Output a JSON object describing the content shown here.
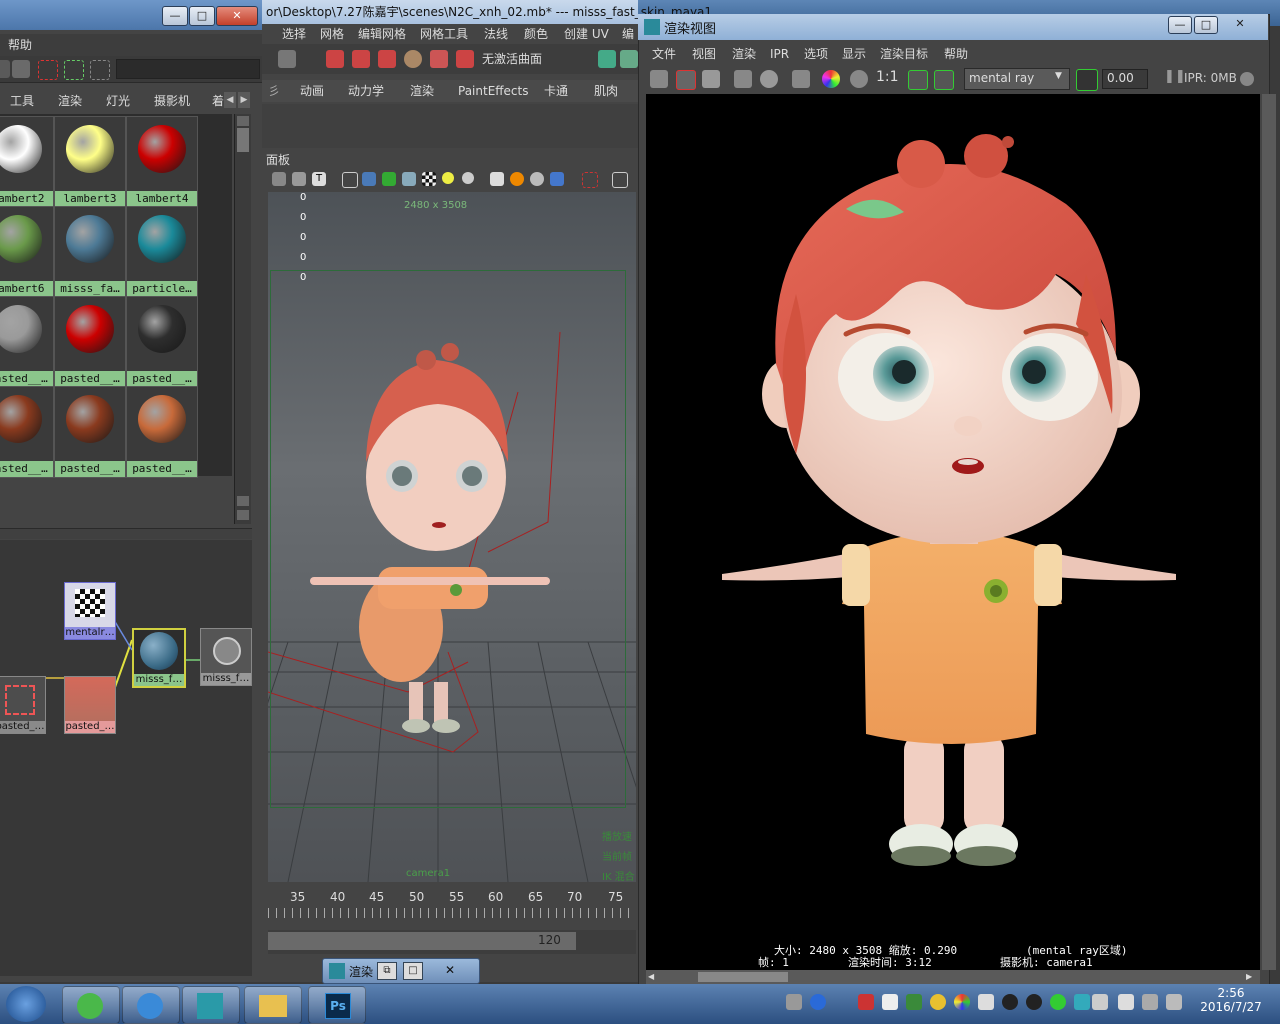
{
  "hypershade": {
    "menu": {
      "help": "帮助"
    },
    "tabs": [
      "工具",
      "渲染",
      "灯光",
      "摄影机",
      "着"
    ],
    "swatches": [
      {
        "label": "lambert2",
        "color": "#ffffff"
      },
      {
        "label": "lambert3",
        "color": "#ffff88"
      },
      {
        "label": "lambert4",
        "color": "#cc0000"
      },
      {
        "label": "lambert6",
        "color": "#6a9a4a"
      },
      {
        "label": "misss_fa…",
        "color": "#4d7a96"
      },
      {
        "label": "particle…",
        "color": "#1a8a9a"
      },
      {
        "label": "pasted__…",
        "color": "#9a9a9a"
      },
      {
        "label": "pasted__…",
        "color": "#cc0000"
      },
      {
        "label": "pasted__…",
        "color": "#2e2e2e"
      },
      {
        "label": "pasted__…",
        "color": "#8a3a1e"
      },
      {
        "label": "pasted__…",
        "color": "#8a3a1e"
      },
      {
        "label": "pasted__…",
        "color": "#c86a3a"
      }
    ],
    "nodes": {
      "mentalray": "mentalr…",
      "misss_f": "misss_f…",
      "misss_f2": "misss_f…",
      "pasted1": "pasted_…",
      "pasted2": "pasted_…"
    }
  },
  "maya_main": {
    "title": "or\\Desktop\\7.27陈嘉宇\\scenes\\N2C_xnh_02.mb*  ---  misss_fast_skin_maya1",
    "menu": [
      "选择",
      "网格",
      "编辑网格",
      "网格工具",
      "法线",
      "颜色",
      "创建 UV",
      "编"
    ],
    "toolbar_field": "无激活曲面",
    "shelf_tabs": [
      "动画",
      "动力学",
      "渲染",
      "PaintEffects",
      "卡通",
      "肌肉"
    ],
    "panel_label": "面板",
    "hud_values": [
      "0",
      "0",
      "0",
      "0",
      "0"
    ],
    "resolution": "2480 x 3508",
    "camera": "camera1",
    "hud_right": [
      "播放速",
      "当前帧",
      "IK 混合"
    ],
    "timeline_ticks": [
      "35",
      "40",
      "45",
      "50",
      "55",
      "60",
      "65",
      "70",
      "75"
    ],
    "range_end": "120"
  },
  "renderview": {
    "title": "渲染视图",
    "menu": [
      "文件",
      "视图",
      "渲染",
      "IPR",
      "选项",
      "显示",
      "渲染目标",
      "帮助"
    ],
    "ratio": "1:1",
    "renderer": "mental ray",
    "exposure": "0.00",
    "ipr": "IPR: 0MB",
    "info_line1": "大小: 2480 x 3508 缩放: 0.290",
    "info_region": "(mental ray区域)",
    "info_frame": "帧: 1",
    "info_time": "渲染时间:  3:12",
    "info_camera": "摄影机: camera1"
  },
  "taskbar": {
    "time": "2:56",
    "date": "2016/7/27"
  },
  "colors": {
    "swatch_label_bg": "#8bc58b",
    "render_bg": "#000000",
    "hair": "#d9564a",
    "dress": "#f0a866",
    "skin": "#f3d5c8"
  }
}
